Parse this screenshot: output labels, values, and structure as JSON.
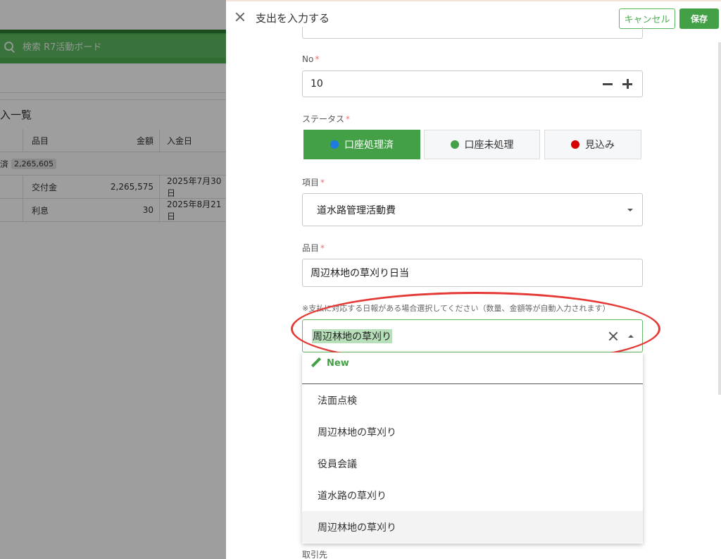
{
  "background": {
    "search_placeholder": "検索 R7活動ボード",
    "list_title": "入一覧",
    "table_headers": [
      "品目",
      "金額",
      "入金日"
    ],
    "group_label": "済",
    "group_total": "2,265,605",
    "rows": [
      {
        "item": "交付金",
        "amount": "2,265,575",
        "date": "2025年7月30日"
      },
      {
        "item": "利息",
        "amount": "30",
        "date": "2025年8月21日"
      }
    ]
  },
  "panel": {
    "title": "支出を入力する",
    "cancel_label": "キャンセル",
    "save_label": "保存"
  },
  "form": {
    "no": {
      "label": "No",
      "value": "10"
    },
    "status": {
      "label": "ステータス",
      "options": [
        {
          "label": "口座処理済",
          "color": "#1e7be0",
          "active": true
        },
        {
          "label": "口座未処理",
          "color": "#43a047",
          "active": false
        },
        {
          "label": "見込み",
          "color": "#d50000",
          "active": false
        }
      ]
    },
    "category": {
      "label": "項目",
      "value": "道水路管理活動費"
    },
    "item": {
      "label": "品目",
      "value": "周辺林地の草刈り日当"
    },
    "report": {
      "hint": "※支払に対応する日報がある場合選択してください（数量、金額等が自動入力されます）",
      "value": "周辺林地の草刈り",
      "new_label": "New",
      "options": [
        "法面点検",
        "周辺林地の草刈り",
        "役員会議",
        "道水路の草刈り",
        "周辺林地の草刈り"
      ]
    },
    "partner": {
      "label": "取引先"
    }
  },
  "colors": {
    "accent": "#43a047",
    "highlight_ring": "#e53935"
  }
}
